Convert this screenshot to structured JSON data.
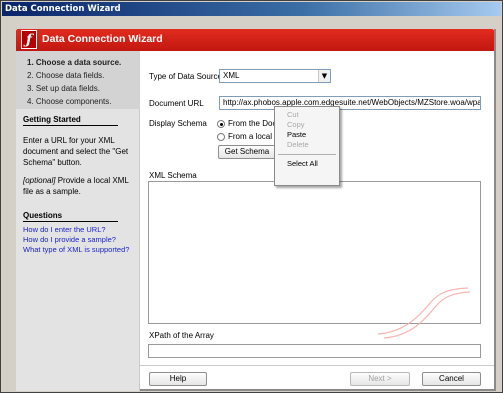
{
  "window": {
    "title": "Data Connection Wizard"
  },
  "header": {
    "title": "Data Connection Wizard",
    "logo_icon": "flash-f-logo"
  },
  "steps": [
    {
      "label": "1. Choose a data source.",
      "active": true
    },
    {
      "label": "2. Choose data fields.",
      "active": false
    },
    {
      "label": "3. Set up data fields.",
      "active": false
    },
    {
      "label": "4. Choose components.",
      "active": false
    }
  ],
  "getting_started": {
    "title": "Getting Started",
    "text1": "Enter a URL for your XML document and select the \"Get Schema\" button.",
    "text2_prefix": "[optional]",
    "text2": " Provide a local XML file as a sample."
  },
  "questions": {
    "title": "Questions",
    "links": [
      "How do I enter the URL?",
      "How do I provide a sample?",
      "What type of XML is supported?"
    ]
  },
  "form": {
    "data_source_label": "Type of Data Source",
    "data_source_value": "XML",
    "document_url_label": "Document URL",
    "document_url_value": "http://ax.phobos.apple.com.edgesuite.net/WebObjects/MZStore.woa/wpa/MRSS",
    "display_schema_label": "Display Schema",
    "radio_from_document": "From the Docu",
    "radio_from_local": "From a local fil",
    "get_schema_button": "Get Schema",
    "xml_schema_label": "XML Schema",
    "xpath_label": "XPath of the Array"
  },
  "context_menu": {
    "items": [
      {
        "label": "Cut",
        "enabled": false
      },
      {
        "label": "Copy",
        "enabled": false
      },
      {
        "label": "Paste",
        "enabled": true
      },
      {
        "label": "Delete",
        "enabled": false
      },
      {
        "label": "Select All",
        "enabled": true
      }
    ]
  },
  "footer": {
    "help_button": "Help",
    "next_button": "Next >",
    "cancel_button": "Cancel"
  },
  "colors": {
    "header_red": "#d9221a",
    "link_blue": "#1a23c8",
    "title_blue": "#0a246a"
  }
}
